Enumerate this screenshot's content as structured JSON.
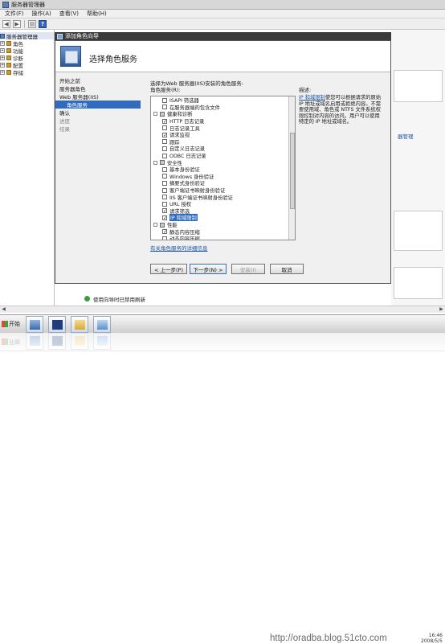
{
  "window": {
    "title": "服务器管理器"
  },
  "menu": [
    "文件(F)",
    "操作(A)",
    "查看(V)",
    "帮助(H)"
  ],
  "tree": [
    {
      "label": "服务器管理器",
      "root": true
    },
    {
      "label": "角色"
    },
    {
      "label": "功能"
    },
    {
      "label": "诊断"
    },
    {
      "label": "配置"
    },
    {
      "label": "存储"
    }
  ],
  "wizard": {
    "title": "添加角色向导",
    "heading": "选择角色服务",
    "steps": [
      {
        "label": "开始之前",
        "state": "normal"
      },
      {
        "label": "服务器角色",
        "state": "normal"
      },
      {
        "label": "Web 服务器(IIS)",
        "state": "normal"
      },
      {
        "label": "角色服务",
        "state": "active"
      },
      {
        "label": "确认",
        "state": "normal"
      },
      {
        "label": "进度",
        "state": "dim"
      },
      {
        "label": "结果",
        "state": "dim"
      }
    ],
    "intro": "选择为Web 服务器(IIS)安装的角色服务:",
    "list_label": "角色服务(R):",
    "role_services": [
      {
        "label": "ISAPI 筛选器",
        "indent": 2,
        "checkbox": "unchecked"
      },
      {
        "label": "在服务器端的包含文件",
        "indent": 2,
        "checkbox": "unchecked"
      },
      {
        "label": "健康和诊断",
        "indent": 1,
        "checkbox": "partial",
        "expander": true
      },
      {
        "label": "HTTP 日志记录",
        "indent": 2,
        "checkbox": "checked"
      },
      {
        "label": "日志记录工具",
        "indent": 2,
        "checkbox": "unchecked"
      },
      {
        "label": "请求监视",
        "indent": 2,
        "checkbox": "checked"
      },
      {
        "label": "跟踪",
        "indent": 2,
        "checkbox": "unchecked"
      },
      {
        "label": "自定义日志记录",
        "indent": 2,
        "checkbox": "unchecked"
      },
      {
        "label": "ODBC 日志记录",
        "indent": 2,
        "checkbox": "unchecked"
      },
      {
        "label": "安全性",
        "indent": 1,
        "checkbox": "partial",
        "expander": true
      },
      {
        "label": "基本身份验证",
        "indent": 2,
        "checkbox": "unchecked"
      },
      {
        "label": "Windows 身份验证",
        "indent": 2,
        "checkbox": "unchecked"
      },
      {
        "label": "摘要式身份验证",
        "indent": 2,
        "checkbox": "unchecked"
      },
      {
        "label": "客户端证书映射身份验证",
        "indent": 2,
        "checkbox": "unchecked"
      },
      {
        "label": "IIS 客户端证书映射身份验证",
        "indent": 2,
        "checkbox": "unchecked"
      },
      {
        "label": "URL 授权",
        "indent": 2,
        "checkbox": "unchecked"
      },
      {
        "label": "请求筛选",
        "indent": 2,
        "checkbox": "checked"
      },
      {
        "label": "IP 和域限制",
        "indent": 2,
        "checkbox": "checked",
        "selected": true
      },
      {
        "label": "性能",
        "indent": 1,
        "checkbox": "partial",
        "expander": true
      },
      {
        "label": "静态内容压缩",
        "indent": 2,
        "checkbox": "checked"
      },
      {
        "label": "动态内容压缩",
        "indent": 2,
        "checkbox": "unchecked"
      }
    ],
    "description_label": "描述:",
    "description_link": "IP 和域限制",
    "description_text": "使您可以根据请求的原始 IP 地址或域名启用或拒绝内容。不需要使用域、角色或 NTFS 文件系统权限控制对内容的访问。用户可以使用特定的 IP 地址或域名。",
    "more_link": "有关角色服务的详细信息",
    "buttons": {
      "back": "< 上一步(P)",
      "next": "下一步(N) >",
      "install": "安装(I)",
      "cancel": "取消"
    }
  },
  "right_pane": {
    "link": "器管理"
  },
  "status": {
    "text": "使用向导时已禁用刷新"
  },
  "taskbar": {
    "start": "开始",
    "watermark": "http://oradba.blog.51cto.com",
    "clock_time": "16:46",
    "clock_date": "2008/5/5"
  }
}
